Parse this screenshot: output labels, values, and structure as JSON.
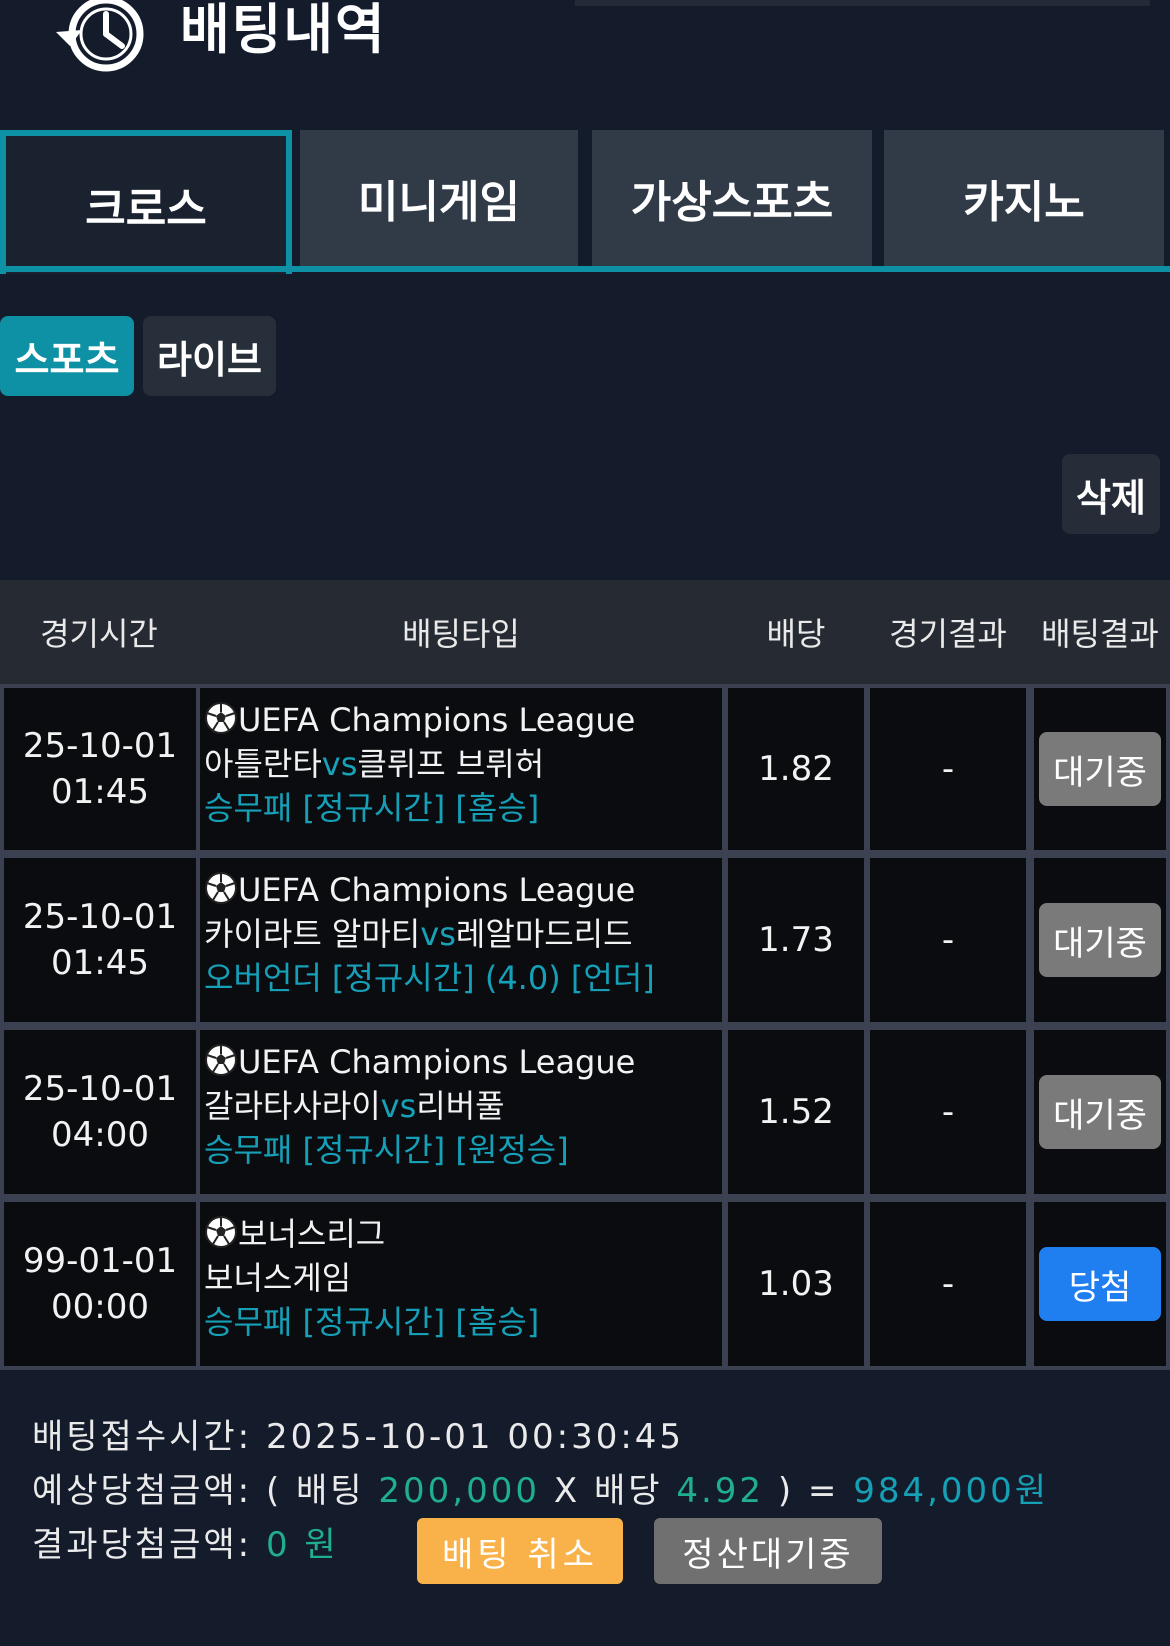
{
  "header": {
    "title": "배팅내역",
    "icon": "history-clock-icon"
  },
  "tabs": [
    {
      "label": "크로스",
      "active": true
    },
    {
      "label": "미니게임",
      "active": false
    },
    {
      "label": "가상스포츠",
      "active": false
    },
    {
      "label": "카지노",
      "active": false
    }
  ],
  "subtabs": [
    {
      "label": "스포츠",
      "active": true
    },
    {
      "label": "라이브",
      "active": false
    }
  ],
  "delete_label": "삭제",
  "table": {
    "headers": [
      "경기시간",
      "배팅타입",
      "배당",
      "경기결과",
      "배팅결과"
    ],
    "rows": [
      {
        "date": "25-10-01",
        "time": "01:45",
        "league": "UEFA Champions League",
        "home": "아틀란타",
        "vs": "vs",
        "away": "클뤼프 브뤼허",
        "market": "승무패 [정규시간] [홈승]",
        "odds": "1.82",
        "result": "-",
        "status": "대기중"
      },
      {
        "date": "25-10-01",
        "time": "01:45",
        "league": "UEFA Champions League",
        "home": "카이라트 알마티",
        "vs": "vs",
        "away": "레알마드리드",
        "market": "오버언더 [정규시간] (4.0) [언더]",
        "odds": "1.73",
        "result": "-",
        "status": "대기중"
      },
      {
        "date": "25-10-01",
        "time": "04:00",
        "league": "UEFA Champions League",
        "home": "갈라타사라이",
        "vs": "vs",
        "away": "리버풀",
        "market": "승무패 [정규시간] [원정승]",
        "odds": "1.52",
        "result": "-",
        "status": "대기중"
      },
      {
        "date": "99-01-01",
        "time": "00:00",
        "league": "보너스리그",
        "home": "보너스게임",
        "vs": "",
        "away": "",
        "market": "승무패 [정규시간] [홈승]",
        "odds": "1.03",
        "result": "-",
        "status": "당첨"
      }
    ]
  },
  "summary": {
    "receipt_label": "배팅접수시간:",
    "receipt_time": "2025-10-01 00:30:45",
    "expected_label": "예상당첨금액:",
    "open_paren": "(",
    "bet_label": "배팅",
    "bet_amount": "200,000",
    "times": "X",
    "odds_label": "배당",
    "total_odds": "4.92",
    "close_eq": ") =",
    "expected_amount": "984,000원",
    "result_label": "결과당첨금액:",
    "result_amount": "0",
    "result_unit": "원",
    "cancel_label": "배팅 취소",
    "settle_label": "정산대기중"
  },
  "colors": {
    "accent": "#0e90a5",
    "pending": "#7a7a7a",
    "win": "#1f7ef0",
    "cancel": "#f9b24a",
    "green": "#1fae8f"
  }
}
